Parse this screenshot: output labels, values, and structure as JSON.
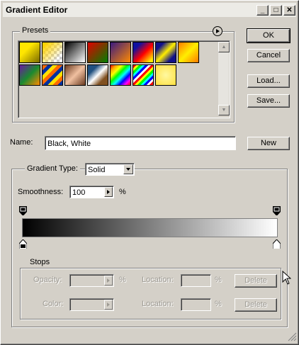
{
  "title": "Gradient Editor",
  "titlebar_buttons": {
    "minimize": "_",
    "maximize": "□",
    "close": "✕"
  },
  "presets": {
    "label": "Presets",
    "menu_icon": "circle-arrow-icon",
    "swatches": [
      {
        "name": "yellow-to-dark"
      },
      {
        "name": "yellow-transparent-checker"
      },
      {
        "name": "black-white"
      },
      {
        "name": "red-green"
      },
      {
        "name": "violet-orange"
      },
      {
        "name": "blue-red-yellow"
      },
      {
        "name": "blue-yellow-blue"
      },
      {
        "name": "orange-yellow-orange"
      },
      {
        "name": "violet-green-orange"
      },
      {
        "name": "transparent-stripes"
      },
      {
        "name": "copper"
      },
      {
        "name": "chrome"
      },
      {
        "name": "spectrum"
      },
      {
        "name": "transparent-rainbow"
      },
      {
        "name": "yellow-checker"
      }
    ]
  },
  "buttons": {
    "ok": "OK",
    "cancel": "Cancel",
    "load": "Load...",
    "save": "Save...",
    "new": "New"
  },
  "name": {
    "label": "Name:",
    "value": "Black, White"
  },
  "gradient_type": {
    "label": "Gradient Type:",
    "value": "Solid"
  },
  "smoothness": {
    "label": "Smoothness:",
    "value": "100",
    "unit": "%"
  },
  "stops": {
    "label": "Stops",
    "opacity_label": "Opacity:",
    "percent": "%",
    "color_label": "Color:",
    "location_label": "Location:",
    "delete_label": "Delete"
  },
  "gradient_colors": {
    "start": "#000000",
    "end": "#ffffff"
  }
}
